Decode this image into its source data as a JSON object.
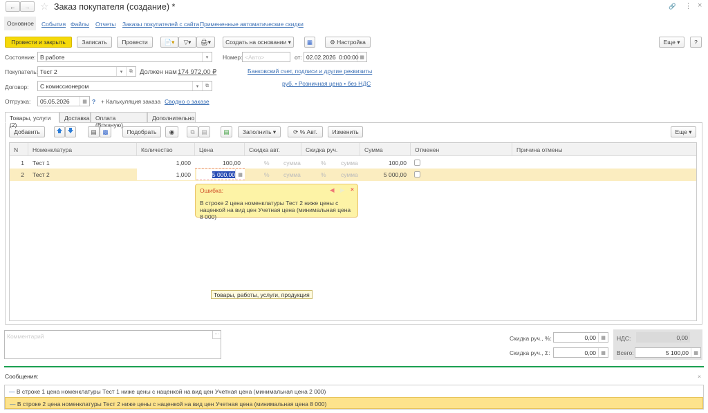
{
  "window": {
    "title": "Заказ покупателя (создание) *"
  },
  "nav_tabs": [
    "Основное",
    "События",
    "Файлы",
    "Отчеты",
    "Заказы покупателей с сайта",
    "Примененные автоматические скидки"
  ],
  "toolbar": {
    "post_close": "Провести и закрыть",
    "save": "Записать",
    "post": "Провести",
    "create_based": "Создать на основании",
    "settings": "Настройка",
    "more": "Еще",
    "help": "?"
  },
  "form": {
    "state_label": "Состояние:",
    "state_value": "В работе",
    "number_label": "Номер:",
    "number_placeholder": "<Авто>",
    "date_label": "от:",
    "date_value": "02.02.2026  0:00:00",
    "customer_label": "Покупатель:",
    "customer_value": "Тест 2",
    "debt_label": "Должен нам",
    "debt_value": "174 972,00 ₽",
    "bank_link": "Банковский счет, подписи и другие реквизиты",
    "price_link": "руб. • Розничная цена • без НДС",
    "contract_label": "Договор:",
    "contract_value": "С комиссионером",
    "shipment_label": "Отгрузка:",
    "shipment_value": "05.05.2026",
    "shipment_help": "?",
    "calc_label": "+ Калькуляция заказа",
    "summary_link": "Сводно о заказе"
  },
  "sub_tabs": [
    "Товары, услуги (2)",
    "Доставка",
    "Оплата (Вручную)",
    "Дополнительно"
  ],
  "table_toolbar": {
    "add": "Добавить",
    "pick": "Подобрать",
    "fill": "Заполнить",
    "auto_pct": "% Авт.",
    "change": "Изменить",
    "more": "Еще"
  },
  "table": {
    "columns": [
      "N",
      "Номенклатура",
      "Количество",
      "Цена",
      "Скидка авт.",
      "Скидка руч.",
      "Сумма",
      "Отменен",
      "Причина отмены"
    ],
    "rows": [
      {
        "n": "1",
        "item": "Тест 1",
        "qty": "1,000",
        "price": "100,00",
        "auto_pct": "%",
        "auto_sum": "сумма",
        "man_pct": "%",
        "man_sum": "сумма",
        "sum": "100,00"
      },
      {
        "n": "2",
        "item": "Тест 2",
        "qty": "1,000",
        "price": "5 000,00",
        "auto_pct": "%",
        "auto_sum": "сумма",
        "man_pct": "%",
        "man_sum": "сумма",
        "sum": "5 000,00"
      }
    ]
  },
  "error_popup": {
    "title": "Ошибка:",
    "text": "В строке 2 цена номенклатуры Тест 2 ниже цены с наценкой на вид цен Учетная цена (минимальная цена 8 000)"
  },
  "tooltip": "Товары, работы, услуги, продукция",
  "footer": {
    "comment_placeholder": "Комментарий",
    "disc_pct_label": "Скидка руч., %:",
    "disc_pct_value": "0,00",
    "disc_sum_label": "Скидка руч., Σ:",
    "disc_sum_value": "0,00",
    "vat_label": "НДС:",
    "vat_value": "0,00",
    "total_label": "Всего:",
    "total_value": "5 100,00"
  },
  "messages": {
    "title": "Сообщения:",
    "items": [
      "В строке 1 цена номенклатуры Тест 1 ниже цены с наценкой на вид цен Учетная цена (минимальная цена 2 000)",
      "В строке 2 цена номенклатуры Тест 2 ниже цены с наценкой на вид цен Учетная цена (минимальная цена 8 000)"
    ]
  },
  "colors": {
    "accent_yellow": "#f5d90a",
    "selected_row": "#fbedc0",
    "green_line": "#1aa050",
    "link": "#3a6fb5"
  }
}
